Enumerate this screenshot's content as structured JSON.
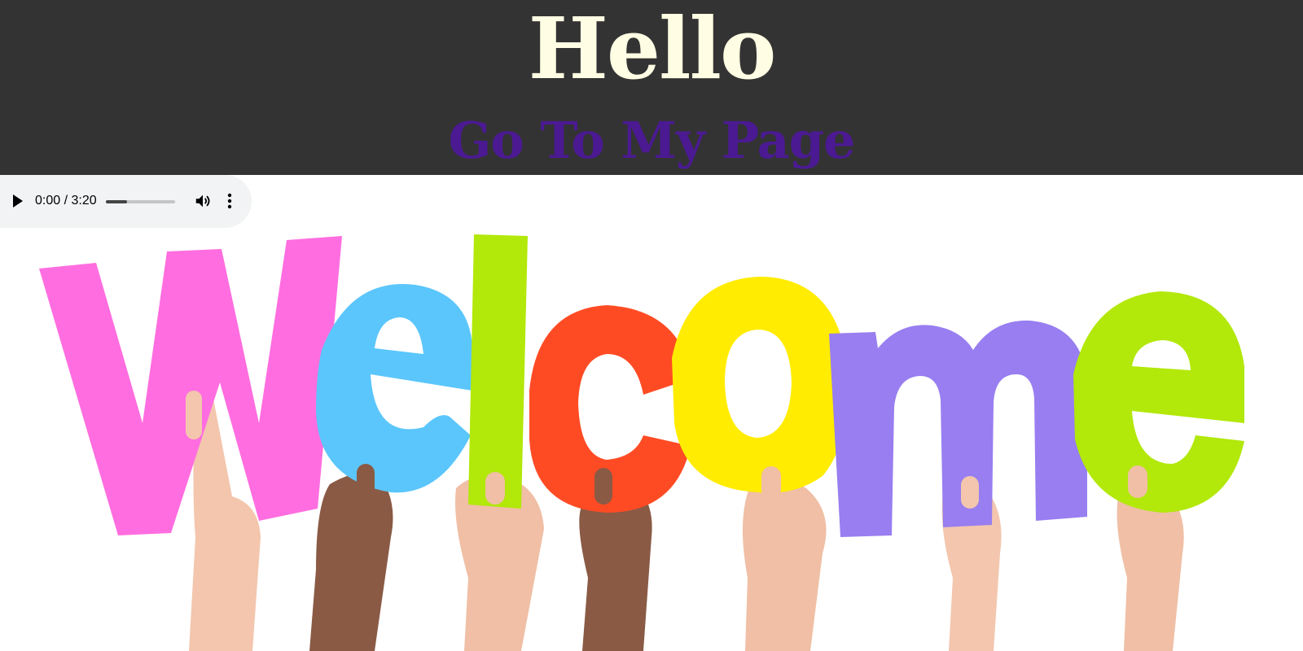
{
  "header": {
    "title": "Hello",
    "link_label": "Go To My Page",
    "background": "#333333",
    "title_color": "#fffde3",
    "link_color": "#4b1a92"
  },
  "audio": {
    "current_time": "0:00",
    "separator": " / ",
    "duration": "3:20",
    "buffered_fraction": 0.3,
    "icons": [
      "play-icon",
      "volume-icon",
      "more-options-icon"
    ]
  },
  "image": {
    "word": "Welcome",
    "letter_colors": [
      "#ff6de0",
      "#5bc6fb",
      "#b2e80a",
      "#ff4b24",
      "#ffec00",
      "#987ef0",
      "#b2e80a"
    ],
    "skin_colors": [
      "#f3c6ad",
      "#8a5a45",
      "#f0bfa5"
    ]
  }
}
